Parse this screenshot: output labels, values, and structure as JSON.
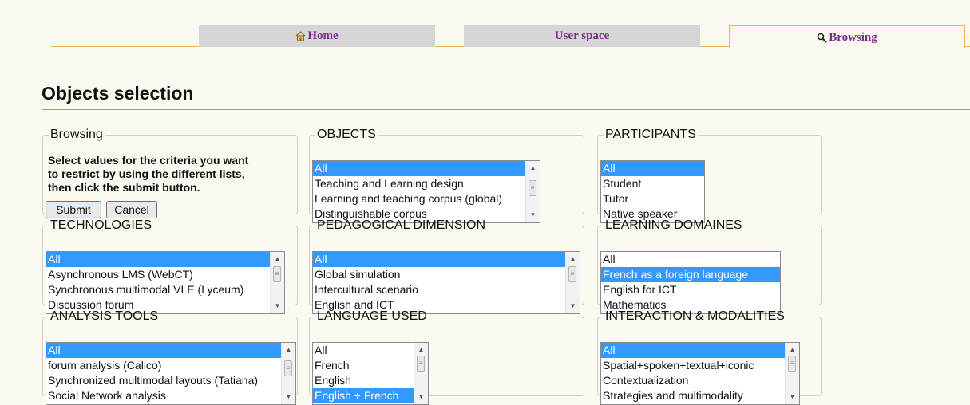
{
  "nav": {
    "tabs": [
      {
        "label": "Home",
        "icon": "home-icon"
      },
      {
        "label": "User space",
        "icon": ""
      },
      {
        "label": "Browsing",
        "icon": "search-icon"
      }
    ]
  },
  "page": {
    "title": "Objects selection"
  },
  "browsing": {
    "legend": "Browsing",
    "instructions": [
      "Select values for the criteria you want",
      "to restrict by using the different lists,",
      "then click the submit button."
    ],
    "submit_label": "Submit",
    "cancel_label": "Cancel"
  },
  "filters": [
    {
      "legend": "OBJECTS",
      "options": [
        "All",
        "Teaching and Learning design",
        "Learning and teaching corpus (global)",
        "Distinguishable corpus"
      ],
      "selected": "All"
    },
    {
      "legend": "PARTICIPANTS",
      "options": [
        "All",
        "Student",
        "Tutor",
        "Native speaker"
      ],
      "selected": "All"
    },
    {
      "legend": "TECHNOLOGIES",
      "options": [
        "All",
        "Asynchronous LMS (WebCT)",
        "Synchronous multimodal VLE (Lyceum)",
        "Discussion forum"
      ],
      "selected": "All"
    },
    {
      "legend": "PEDAGOGICAL DIMENSION",
      "options": [
        "All",
        "Global simulation",
        "Intercultural scenario",
        "English and ICT"
      ],
      "selected": "All"
    },
    {
      "legend": "LEARNING DOMAINES",
      "options": [
        "All",
        "French as a foreign language",
        "English for ICT",
        "Mathematics"
      ],
      "selected": "French as a foreign language"
    },
    {
      "legend": "ANALYSIS TOOLS",
      "options": [
        "All",
        "forum analysis (Calico)",
        "Synchronized multimodal layouts (Tatiana)",
        "Social Network analysis"
      ],
      "selected": "All"
    },
    {
      "legend": "LANGUAGE USED",
      "options": [
        "All",
        "French",
        "English",
        "English + French"
      ],
      "selected": "English + French"
    },
    {
      "legend": "INTERACTION & MODALITIES",
      "options": [
        "All",
        "Spatial+spoken+textual+iconic",
        "Contextualization",
        "Strategies and multimodality"
      ],
      "selected": "All"
    }
  ],
  "colors": {
    "selection": "#3399ff",
    "tab_text": "#7b2d8a",
    "tab_border": "#f0b55a"
  }
}
